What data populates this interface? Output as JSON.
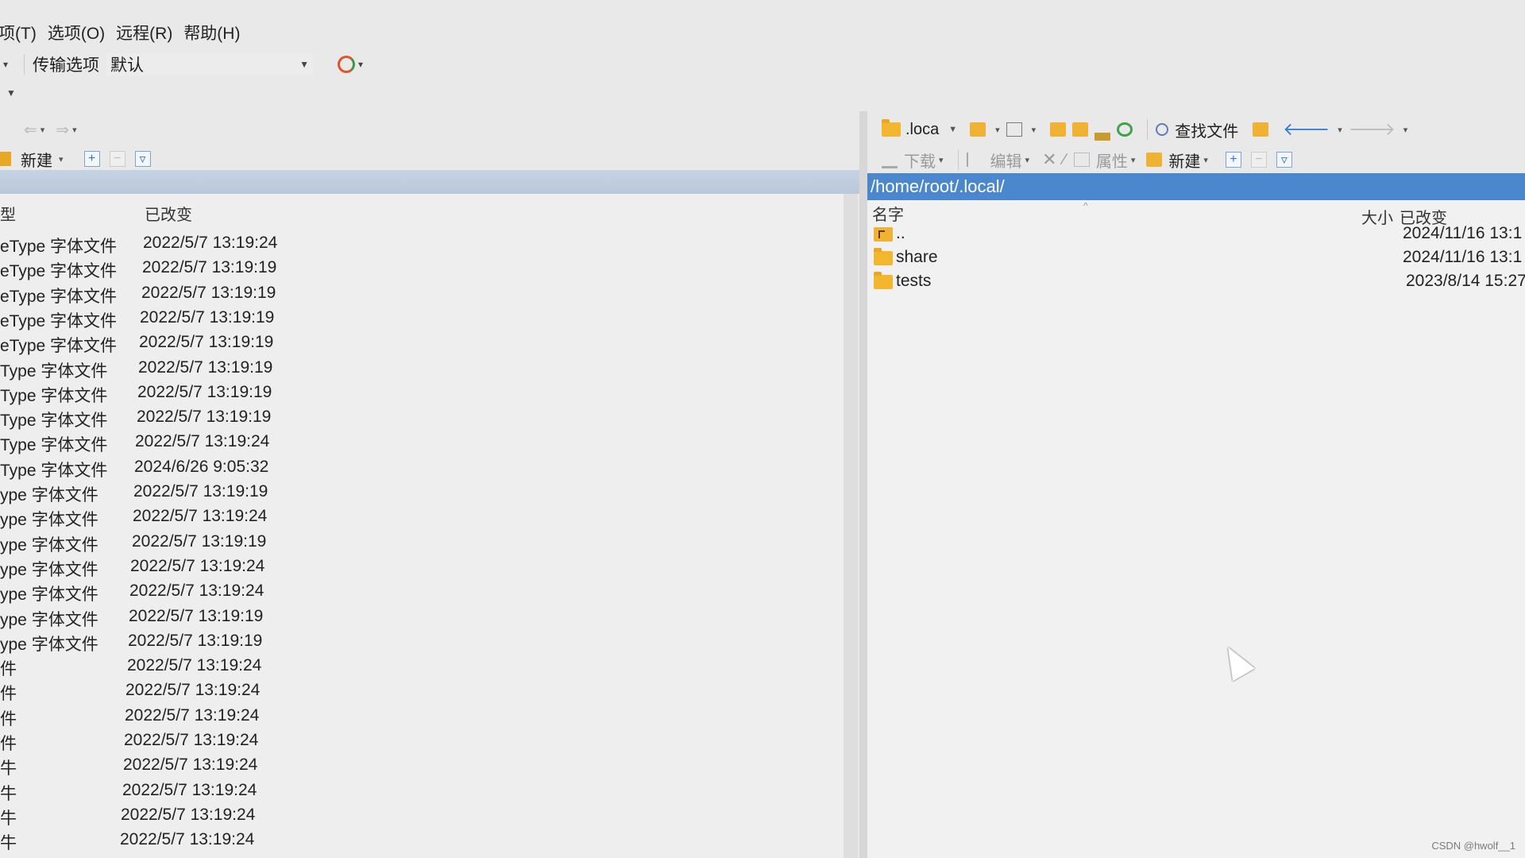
{
  "menu": [
    "项(T)",
    "选项(O)",
    "远程(R)",
    "帮助(H)"
  ],
  "toolbar": {
    "transfer_label": "传输选项",
    "transfer_value": "默认"
  },
  "left_pane": {
    "new_label": "新建",
    "column_changed": "已改变",
    "column_type": "型",
    "rows": [
      {
        "type": "eType 字体文件",
        "changed": "2022/5/7 13:19:24"
      },
      {
        "type": "eType 字体文件",
        "changed": "2022/5/7 13:19:19"
      },
      {
        "type": "eType 字体文件",
        "changed": "2022/5/7 13:19:19"
      },
      {
        "type": "eType 字体文件",
        "changed": "2022/5/7 13:19:19"
      },
      {
        "type": "eType 字体文件",
        "changed": "2022/5/7 13:19:19"
      },
      {
        "type": "Type 字体文件",
        "changed": "2022/5/7 13:19:19"
      },
      {
        "type": "Type 字体文件",
        "changed": "2022/5/7 13:19:19"
      },
      {
        "type": "Type 字体文件",
        "changed": "2022/5/7 13:19:19"
      },
      {
        "type": "Type 字体文件",
        "changed": "2022/5/7 13:19:24"
      },
      {
        "type": "Type 字体文件",
        "changed": "2024/6/26 9:05:32"
      },
      {
        "type": "ype 字体文件",
        "changed": "2022/5/7 13:19:19"
      },
      {
        "type": "ype 字体文件",
        "changed": "2022/5/7 13:19:24"
      },
      {
        "type": "ype 字体文件",
        "changed": "2022/5/7 13:19:19"
      },
      {
        "type": "ype 字体文件",
        "changed": "2022/5/7 13:19:24"
      },
      {
        "type": "ype 字体文件",
        "changed": "2022/5/7 13:19:24"
      },
      {
        "type": "ype 字体文件",
        "changed": "2022/5/7 13:19:19"
      },
      {
        "type": "ype 字体文件",
        "changed": "2022/5/7 13:19:19"
      },
      {
        "type": "件",
        "changed": "2022/5/7 13:19:24"
      },
      {
        "type": "件",
        "changed": "2022/5/7 13:19:24"
      },
      {
        "type": "件",
        "changed": "2022/5/7 13:19:24"
      },
      {
        "type": "件",
        "changed": "2022/5/7 13:19:24"
      },
      {
        "type": "牛",
        "changed": "2022/5/7 13:19:24"
      },
      {
        "type": "牛",
        "changed": "2022/5/7 13:19:24"
      },
      {
        "type": "牛",
        "changed": "2022/5/7 13:19:24"
      },
      {
        "type": "牛",
        "changed": "2022/5/7 13:19:24"
      }
    ]
  },
  "right_pane": {
    "location_label": ".loca",
    "find_files_label": "查找文件",
    "download_label": "下载",
    "edit_label": "编辑",
    "properties_label": "属性",
    "new_label": "新建",
    "path": "/home/root/.local/",
    "column_name": "名字",
    "column_size": "大小",
    "column_changed": "已改变",
    "rows": [
      {
        "name": "..",
        "changed": "2024/11/16 13:1",
        "kind": "parent"
      },
      {
        "name": "share",
        "changed": "2024/11/16 13:1",
        "kind": "folder"
      },
      {
        "name": "tests",
        "changed": "2023/8/14 15:27",
        "kind": "folder"
      }
    ]
  },
  "watermark": "CSDN @hwolf__1"
}
